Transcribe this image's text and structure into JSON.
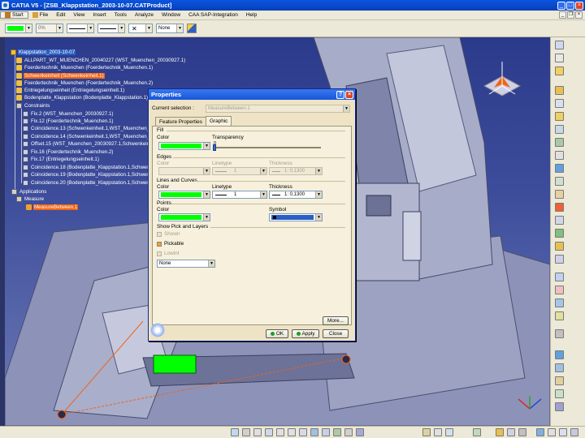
{
  "window": {
    "title": "CATIA V5 - [ZSB_Klappstation_2003-10-07.CATProduct]"
  },
  "menu": {
    "items": [
      "Start",
      "File",
      "Edit",
      "View",
      "Insert",
      "Tools",
      "Analyze",
      "Window",
      "CAA SAP-Integration",
      "Help"
    ]
  },
  "graphic_toolbar": {
    "transparency_value": "0%",
    "layer_value": "None",
    "fill_color": "#00ff00"
  },
  "tree": {
    "root": "Klappstation_2003-10-07",
    "items": [
      "ALLPART_WT_MUENCHEN_20040227 (WST_Muenchen_20030927.1)",
      "Foerdertechnik_Muenchen (Foerdertechnik_Muenchen.1)",
      "Schwenkeinheit (Schwenkeinheit.1)",
      "Foerdertechnik_Muenchen (Foerdertechnik_Muenchen.2)",
      "Entriegelungseinheit (Entriegelungseinheit.1)",
      "Bodenplatte_Klappstation (Bodenplatte_Klappstation.1)"
    ],
    "constraints_label": "Constraints",
    "constraints": [
      "Fix.2 (WST_Muenchen_20030927.1)",
      "Fix.12 (Foerdertechnik_Muenchen.1)",
      "Coincidence.13 (Schwenkeinheit.1,WST_Muenchen_200",
      "Coincidence.14 (Schwenkeinheit.1,WST_Muenchen_200",
      "Offset.15 (WST_Muenchen_20030927.1,Schwenkeinheit.",
      "Fix.16 (Foerdertechnik_Muenchen.2)",
      "Fix.17 (Entriegelungseinheit.1)",
      "Coincidence.18 (Bodenplatte_Klappstation.1,Schwenkei",
      "Coincidence.19 (Bodenplatte_Klappstation.1,Schwenkei",
      "Coincidence.20 (Bodenplatte_Klappstation.1,Schwenkei"
    ],
    "applications_label": "Applications",
    "measure_label": "Measure",
    "measure_item": "MeasureBetween.1"
  },
  "dialog": {
    "title": "Properties",
    "current_selection_label": "Current selection :",
    "current_selection_value": "MeasureBetween.1",
    "tabs": [
      "Feature Properties",
      "Graphic"
    ],
    "active_tab": "Graphic",
    "fill": {
      "section": "Fill",
      "color_label": "Color",
      "transparency_label": "Transparency",
      "transparency_value": "0",
      "color": "#00ff00"
    },
    "edges": {
      "section": "Edges",
      "color_label": "Color",
      "linetype_label": "Linetype",
      "linetype_value": "1",
      "thickness_label": "Thickness",
      "thickness_value": "1: 0,1300"
    },
    "lines": {
      "section": "Lines and Curves",
      "color_label": "Color",
      "linetype_label": "Linetype",
      "linetype_value": "1",
      "thickness_label": "Thickness",
      "thickness_value": "1: 0,1300",
      "color": "#00ff00"
    },
    "points": {
      "section": "Points",
      "color_label": "Color",
      "symbol_label": "Symbol",
      "color": "#00ff00",
      "symbol_color": "#2b5ec4"
    },
    "show_pick": {
      "section": "Show Pick and Layers",
      "shown_label": "Shown",
      "pickable_label": "Pickable",
      "lowint_label": "Lowint",
      "layer_value": "None"
    },
    "buttons": {
      "more": "More...",
      "ok": "OK",
      "apply": "Apply",
      "close": "Close"
    }
  },
  "colors": {
    "selection_orange": "#f06414",
    "accent_blue": "#1656d8",
    "dialog_bg": "#efe3c5"
  }
}
